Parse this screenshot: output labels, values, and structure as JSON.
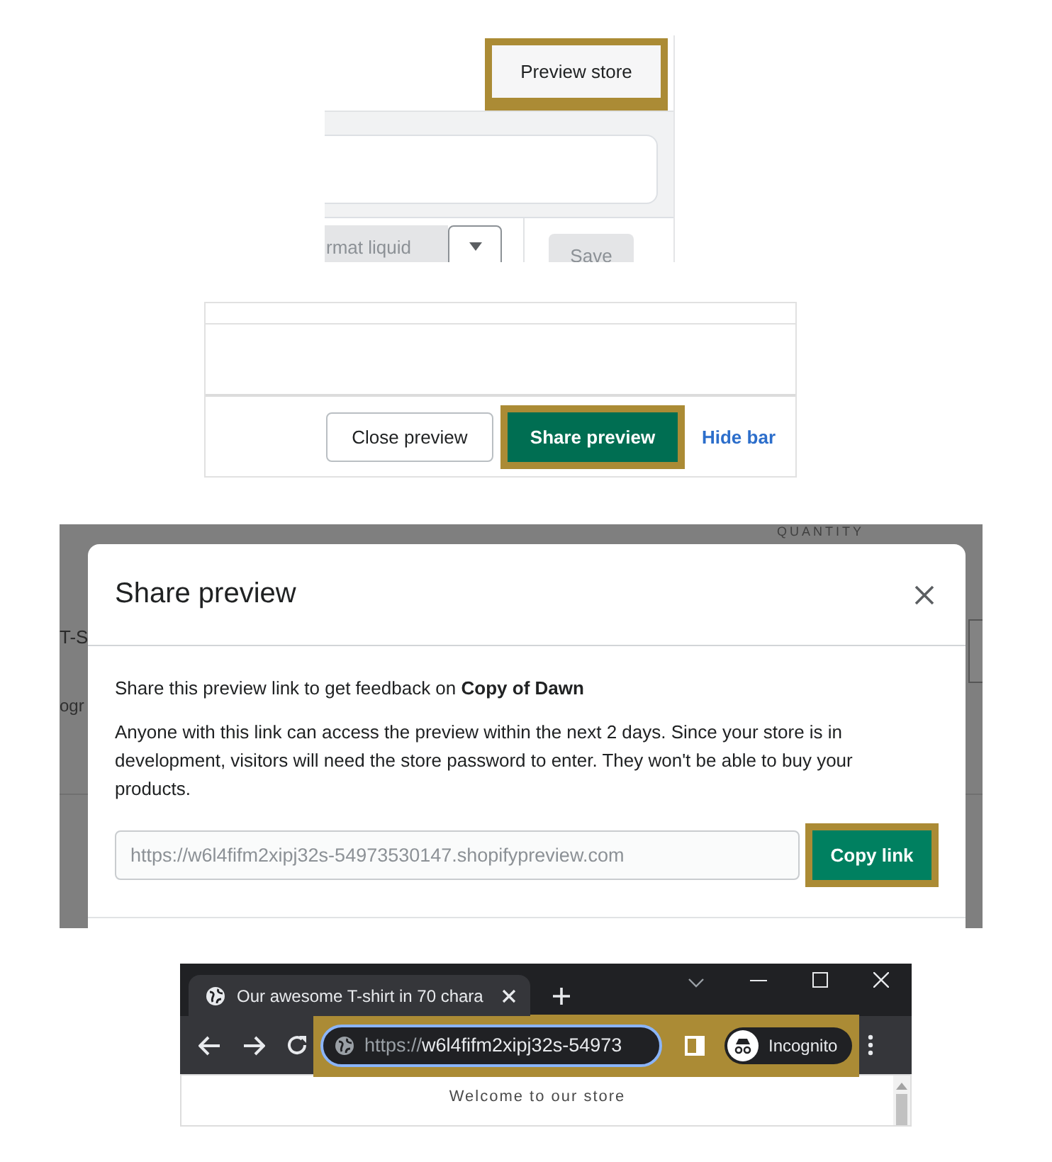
{
  "store_header": {
    "preview_button": {
      "label": "Preview store",
      "highlighted": true
    }
  },
  "code_editor_bar": {
    "format_button": "rmat liquid",
    "save_button": {
      "label": "Save",
      "disabled": true
    }
  },
  "preview_bar": {
    "buttons": [
      {
        "label": "Close preview",
        "kind": "secondary",
        "highlighted": false
      },
      {
        "label": "Share preview",
        "kind": "primary",
        "highlighted": true
      },
      {
        "label": "Hide bar",
        "kind": "link",
        "highlighted": false
      }
    ]
  },
  "share_dialog": {
    "background": {
      "column_heading": "QUANTITY",
      "title_fragment": "T-S",
      "text_fragment": "ogr"
    },
    "title": "Share preview",
    "intro": "Share this preview link to get feedback on **Copy of Dawn**",
    "notice": "Anyone with this link can access the preview within the next 2 days. Since your store is in development, visitors will need the store password to enter. They won't be able to buy your products.",
    "link_field": {
      "value": "https://w6l4fifm2xipj32s-54973530147.shopifypreview.com"
    },
    "copy_button": {
      "label": "Copy link",
      "highlighted": true
    }
  },
  "browser": {
    "tab": {
      "title": "Our awesome T-shirt in 70 chara",
      "selected": true
    },
    "address": {
      "scheme": "https://",
      "host": "w6l4fifm2xipj32s-54973"
    },
    "profile": "Incognito",
    "toolbar_highlighted": true,
    "page_text": "Welcome to our store"
  }
}
